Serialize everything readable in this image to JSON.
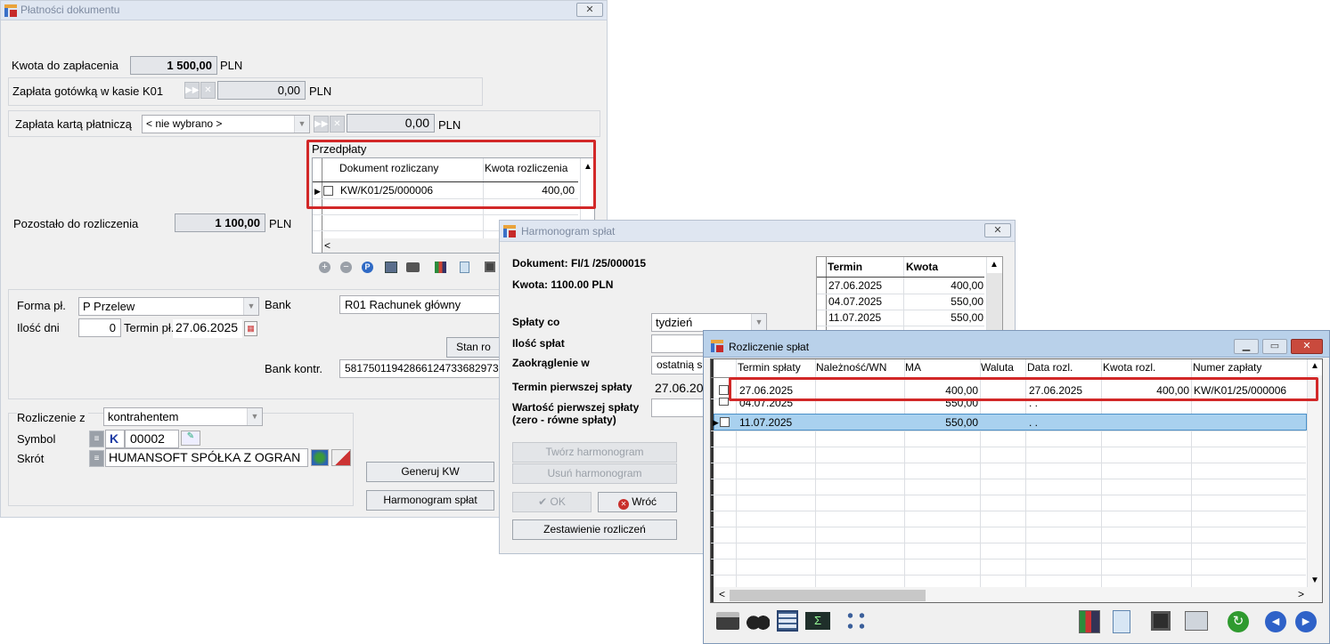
{
  "w1": {
    "title": "Płatności dokumentu",
    "close": "✕",
    "kwota_label": "Kwota do zapłacenia",
    "kwota_value": "1 500,00",
    "currency": "PLN",
    "gotowka_label": "Zapłata gotówką w kasie K01",
    "gotowka_value": "0,00",
    "karta_label": "Zapłata kartą płatniczą",
    "karta_select": "< nie wybrano >",
    "karta_value": "0,00",
    "przedplaty_label": "Przedpłaty",
    "przedplaty_cols": [
      "Dokument rozliczany",
      "Kwota rozliczenia"
    ],
    "przedplaty_rows": [
      {
        "doc": "KW/K01/25/000006",
        "kwota": "400,00"
      }
    ],
    "pozostalo_label": "Pozostało do rozliczenia",
    "pozostalo_value": "1 100,00",
    "forma_label": "Forma pł.",
    "forma_value": "P  Przelew",
    "bank_label": "Bank",
    "bank_value": "R01 Rachunek główny",
    "ilosc_dni_label": "Ilość dni",
    "ilosc_dni_value": "0",
    "termin_label": "Termin pł.",
    "termin_value": "27.06.2025",
    "stan_button": "Stan ro",
    "bank_kontr_label": "Bank kontr.",
    "bank_kontr_value": "58175011942866124733682973",
    "rozliczenie_label": "Rozliczenie z",
    "rozliczenie_value": "kontrahentem",
    "symbol_label": "Symbol",
    "symbol_k": "K",
    "symbol_value": "00002",
    "skrot_label": "Skrót",
    "skrot_value": "HUMANSOFT SPÓŁKA Z OGRAN",
    "generuj_button": "Generuj KW",
    "harmonogram_button": "Harmonogram spłat"
  },
  "w2": {
    "title": "Harmonogram spłat",
    "close": "✕",
    "dokument": "Dokument: FI/1  /25/000015",
    "kwota": "Kwota: 1100.00 PLN",
    "splaty_co_label": "Spłaty co",
    "splaty_co_value": "tydzień",
    "ilosc_splat_label": "Ilość spłat",
    "zaokraglenie_label": "Zaokrąglenie w",
    "zaokraglenie_value": "ostatnią s",
    "termin_pierwszej_label": "Termin pierwszej spłaty",
    "termin_pierwszej_value": "27.06.20",
    "wartosc_label_1": "Wartość pierwszej spłaty",
    "wartosc_label_2": "(zero - równe spłaty)",
    "tworz_button": "Twórz harmonogram",
    "usun_button": "Usuń harmonogram",
    "ok_button": "OK",
    "wroc_button": "Wróć",
    "zestawienie_button": "Zestawienie rozliczeń",
    "grid_cols": [
      "Termin",
      "Kwota"
    ],
    "grid_rows": [
      {
        "termin": "27.06.2025",
        "kwota": "400,00"
      },
      {
        "termin": "04.07.2025",
        "kwota": "550,00"
      },
      {
        "termin": "11.07.2025",
        "kwota": "550,00"
      }
    ]
  },
  "w3": {
    "title": "Rozliczenie spłat",
    "cols": [
      "Termin spłaty",
      "Należność/WN",
      "MA",
      "Waluta",
      "Data rozl.",
      "Kwota rozl.",
      "Numer zapłaty"
    ],
    "rows": [
      {
        "termin": "27.06.2025",
        "naleznosc": "",
        "ma": "400,00",
        "waluta": "",
        "data": "27.06.2025",
        "kwota": "400,00",
        "numer": "KW/K01/25/000006"
      },
      {
        "termin": "04.07.2025",
        "naleznosc": "",
        "ma": "550,00",
        "waluta": "",
        "data": ". .",
        "kwota": "",
        "numer": ""
      },
      {
        "termin": "11.07.2025",
        "naleznosc": "",
        "ma": "550,00",
        "waluta": "",
        "data": ". .",
        "kwota": "",
        "numer": ""
      }
    ]
  },
  "colors": {
    "highlight": "#d22828",
    "selected_row": "#a9d1ef",
    "title_bar": "#dfe6f1"
  }
}
